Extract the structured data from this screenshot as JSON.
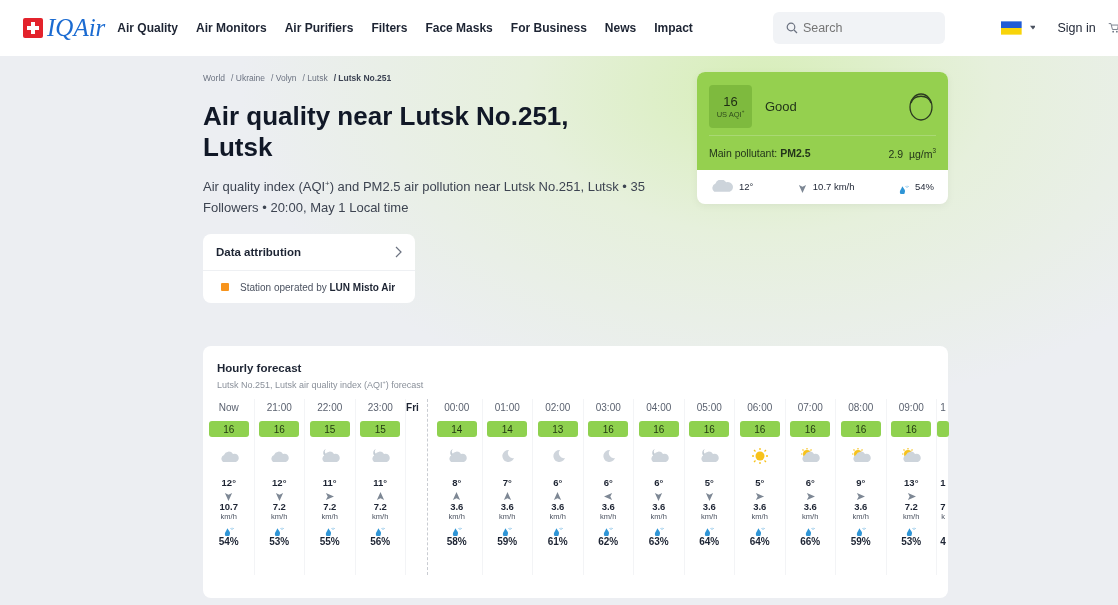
{
  "nav": {
    "logo": "IQAir",
    "links": [
      "Air Quality",
      "Air Monitors",
      "Air Purifiers",
      "Filters",
      "Face Masks",
      "For Business",
      "News",
      "Impact"
    ],
    "search": {
      "placeholder": "Search"
    },
    "sign_in": "Sign in"
  },
  "breadcrumb": [
    {
      "label": "World",
      "current": false
    },
    {
      "label": "/ Ukraine",
      "current": false
    },
    {
      "label": "/ Volyn",
      "current": false
    },
    {
      "label": "/ Lutsk",
      "current": false
    },
    {
      "label": "/ Lutsk No.251",
      "current": true
    }
  ],
  "title": "Air quality near Lutsk No.251, Lutsk",
  "subtitle": "Air quality index (AQI$^{+}$) and PM2.5 air pollution near Lutsk No.251, Lutsk • 35 Followers • 20:00, May 1 Local time",
  "attribution": {
    "title": "Data attribution",
    "text": "Station operated by **LUN Misto Air**",
    "color": "#f7941d"
  },
  "aqi_card": {
    "value": "16",
    "unit": "US AQI$^{+}$",
    "status": "Good",
    "pollutant": "Main pollutant: **PM2.5**",
    "concentration": "2.9  µg/m$^{3}$",
    "temp": "12°",
    "wind": "10.7 km/h",
    "humidity": "54%"
  },
  "forecast": {
    "title": "Hourly forecast",
    "subtitle": "Lutsk No.251, Lutsk air quality index (AQI$^{+}$) forecast",
    "columns": [
      {
        "kind": "hour",
        "time": "Now",
        "aqi": "16",
        "sky": {
          "kind": "cloud"
        },
        "arrow": {
          "kind": "s"
        },
        "temp": "12°",
        "speed": "10.7",
        "unit": "km/h",
        "humidity": "54%"
      },
      {
        "kind": "hour",
        "time": "21:00",
        "aqi": "16",
        "sky": {
          "kind": "cloud"
        },
        "arrow": {
          "kind": "s"
        },
        "temp": "12°",
        "speed": "7.2",
        "unit": "km/h",
        "humidity": "53%"
      },
      {
        "kind": "hour",
        "time": "22:00",
        "aqi": "15",
        "sky": {
          "kind": "cloudnight"
        },
        "arrow": {
          "kind": "e"
        },
        "temp": "11°",
        "speed": "7.2",
        "unit": "km/h",
        "humidity": "55%"
      },
      {
        "kind": "hour",
        "time": "23:00",
        "aqi": "15",
        "sky": {
          "kind": "cloudnight"
        },
        "arrow": {
          "kind": "n"
        },
        "temp": "11°",
        "speed": "7.2",
        "unit": "km/h",
        "humidity": "56%"
      },
      {
        "kind": "day",
        "label": "Fri"
      },
      {
        "kind": "hour",
        "time": "00:00",
        "aqi": "14",
        "sky": {
          "kind": "cloudnight"
        },
        "arrow": {
          "kind": "n"
        },
        "temp": "8°",
        "speed": "3.6",
        "unit": "km/h",
        "humidity": "58%"
      },
      {
        "kind": "hour",
        "time": "01:00",
        "aqi": "14",
        "sky": {
          "kind": "moon"
        },
        "arrow": {
          "kind": "n"
        },
        "temp": "7°",
        "speed": "3.6",
        "unit": "km/h",
        "humidity": "59%"
      },
      {
        "kind": "hour",
        "time": "02:00",
        "aqi": "13",
        "sky": {
          "kind": "moon"
        },
        "arrow": {
          "kind": "n"
        },
        "temp": "6°",
        "speed": "3.6",
        "unit": "km/h",
        "humidity": "61%"
      },
      {
        "kind": "hour",
        "time": "03:00",
        "aqi": "16",
        "sky": {
          "kind": "moon"
        },
        "arrow": {
          "kind": "w"
        },
        "temp": "6°",
        "speed": "3.6",
        "unit": "km/h",
        "humidity": "62%"
      },
      {
        "kind": "hour",
        "time": "04:00",
        "aqi": "16",
        "sky": {
          "kind": "cloudnight"
        },
        "arrow": {
          "kind": "s"
        },
        "temp": "6°",
        "speed": "3.6",
        "unit": "km/h",
        "humidity": "63%"
      },
      {
        "kind": "hour",
        "time": "05:00",
        "aqi": "16",
        "sky": {
          "kind": "cloudnight"
        },
        "arrow": {
          "kind": "s"
        },
        "temp": "5°",
        "speed": "3.6",
        "unit": "km/h",
        "humidity": "64%"
      },
      {
        "kind": "hour",
        "time": "06:00",
        "aqi": "16",
        "sky": {
          "kind": "sun"
        },
        "arrow": {
          "kind": "e"
        },
        "temp": "5°",
        "speed": "3.6",
        "unit": "km/h",
        "humidity": "64%"
      },
      {
        "kind": "hour",
        "time": "07:00",
        "aqi": "16",
        "sky": {
          "kind": "cloudsun"
        },
        "arrow": {
          "kind": "e"
        },
        "temp": "6°",
        "speed": "3.6",
        "unit": "km/h",
        "humidity": "66%"
      },
      {
        "kind": "hour",
        "time": "08:00",
        "aqi": "16",
        "sky": {
          "kind": "cloudsun"
        },
        "arrow": {
          "kind": "e"
        },
        "temp": "9°",
        "speed": "3.6",
        "unit": "km/h",
        "humidity": "59%"
      },
      {
        "kind": "hour",
        "time": "09:00",
        "aqi": "16",
        "sky": {
          "kind": "cloudsun"
        },
        "arrow": {
          "kind": "e"
        },
        "temp": "13°",
        "speed": "7.2",
        "unit": "km/h",
        "humidity": "53%"
      },
      {
        "kind": "partial",
        "time": "1",
        "temp": "1",
        "speed": "7",
        "unit": "k",
        "humidity": "4"
      }
    ]
  }
}
